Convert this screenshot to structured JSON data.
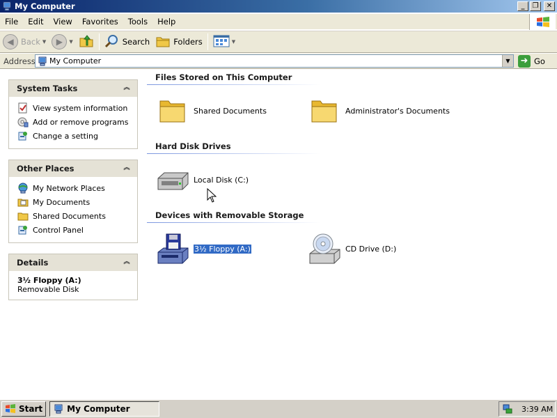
{
  "window": {
    "title": "My Computer"
  },
  "menu": [
    "File",
    "Edit",
    "View",
    "Favorites",
    "Tools",
    "Help"
  ],
  "toolbar": {
    "back": "Back",
    "search": "Search",
    "folders": "Folders"
  },
  "address": {
    "label": "Address",
    "value": "My Computer",
    "go": "Go"
  },
  "panes": {
    "system_tasks": {
      "title": "System Tasks",
      "items": [
        "View system information",
        "Add or remove programs",
        "Change a setting"
      ]
    },
    "other_places": {
      "title": "Other Places",
      "items": [
        "My Network Places",
        "My Documents",
        "Shared Documents",
        "Control Panel"
      ]
    },
    "details": {
      "title": "Details",
      "name": "3½ Floppy (A:)",
      "type": "Removable Disk"
    }
  },
  "groups": {
    "files": {
      "title": "Files Stored on This Computer",
      "items": [
        "Shared Documents",
        "Administrator's Documents"
      ]
    },
    "hard_disks": {
      "title": "Hard Disk Drives",
      "items": [
        "Local Disk (C:)"
      ]
    },
    "removable": {
      "title": "Devices with Removable Storage",
      "items": [
        "3½ Floppy (A:)",
        "CD Drive (D:)"
      ]
    }
  },
  "taskbar": {
    "start": "Start",
    "task": "My Computer",
    "clock": "3:39 AM"
  },
  "colors": {
    "selection": "#316ac5",
    "title_gradient_start": "#0a246a",
    "folder": "#f0c848"
  }
}
